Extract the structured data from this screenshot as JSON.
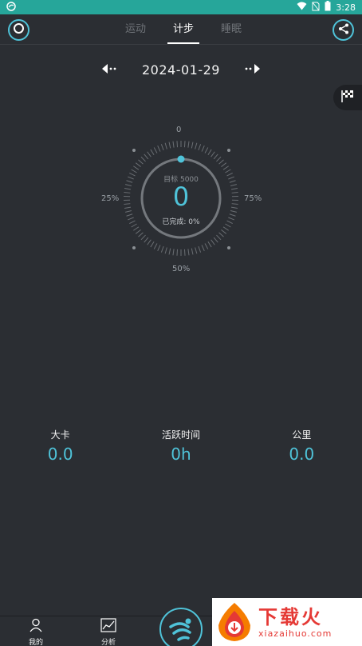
{
  "status_bar": {
    "time": "3:28"
  },
  "tabs": [
    {
      "label": "运动",
      "active": false
    },
    {
      "label": "计步",
      "active": true
    },
    {
      "label": "睡眠",
      "active": false
    }
  ],
  "date_nav": {
    "date": "2024-01-29"
  },
  "gauge": {
    "label_top": "0",
    "label_left": "25%",
    "label_right": "75%",
    "label_bottom": "50%",
    "goal": "目标 5000",
    "steps": "0",
    "completed": "已完成: 0%",
    "progress": 0
  },
  "stats": [
    {
      "label": "大卡",
      "value": "0.0"
    },
    {
      "label": "活跃时间",
      "value": "0h"
    },
    {
      "label": "公里",
      "value": "0.0"
    }
  ],
  "bottom_nav": {
    "me_label": "我的",
    "analysis_label": "分析"
  },
  "watermark": {
    "brand": "下载火",
    "url": "xiazaihuo.com"
  },
  "colors": {
    "accent": "#4fc3d9",
    "status_bar": "#26a69a",
    "background": "#2b2e33"
  }
}
